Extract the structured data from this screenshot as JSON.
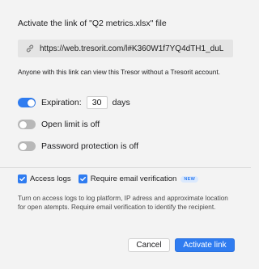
{
  "dialog": {
    "title": "Activate the link of \"Q2 metrics.xlsx\" file",
    "link_url": "https://web.tresorit.com/l#K360W1f7YQ4dTH1_duL",
    "notice": "Anyone with this link can view this Tresor without a Tresorit account."
  },
  "options": {
    "expiration": {
      "label": "Expiration:",
      "enabled": true,
      "days_value": "30",
      "unit": "days"
    },
    "open_limit": {
      "label": "Open limit is off",
      "enabled": false
    },
    "password": {
      "label": "Password protection is off",
      "enabled": false
    }
  },
  "checks": {
    "access_logs": {
      "label": "Access logs",
      "checked": true
    },
    "email_verification": {
      "label": "Require email verification",
      "checked": true,
      "badge": "NEW"
    }
  },
  "help_text": "Turn on access logs to log platform, IP adress and approximate location for open atempts. Require email verification to identify the recipient.",
  "buttons": {
    "cancel": "Cancel",
    "primary": "Activate link"
  },
  "colors": {
    "accent": "#2f7cf0",
    "toggle_off": "#b8b8b8",
    "background": "#f3f3f3"
  }
}
